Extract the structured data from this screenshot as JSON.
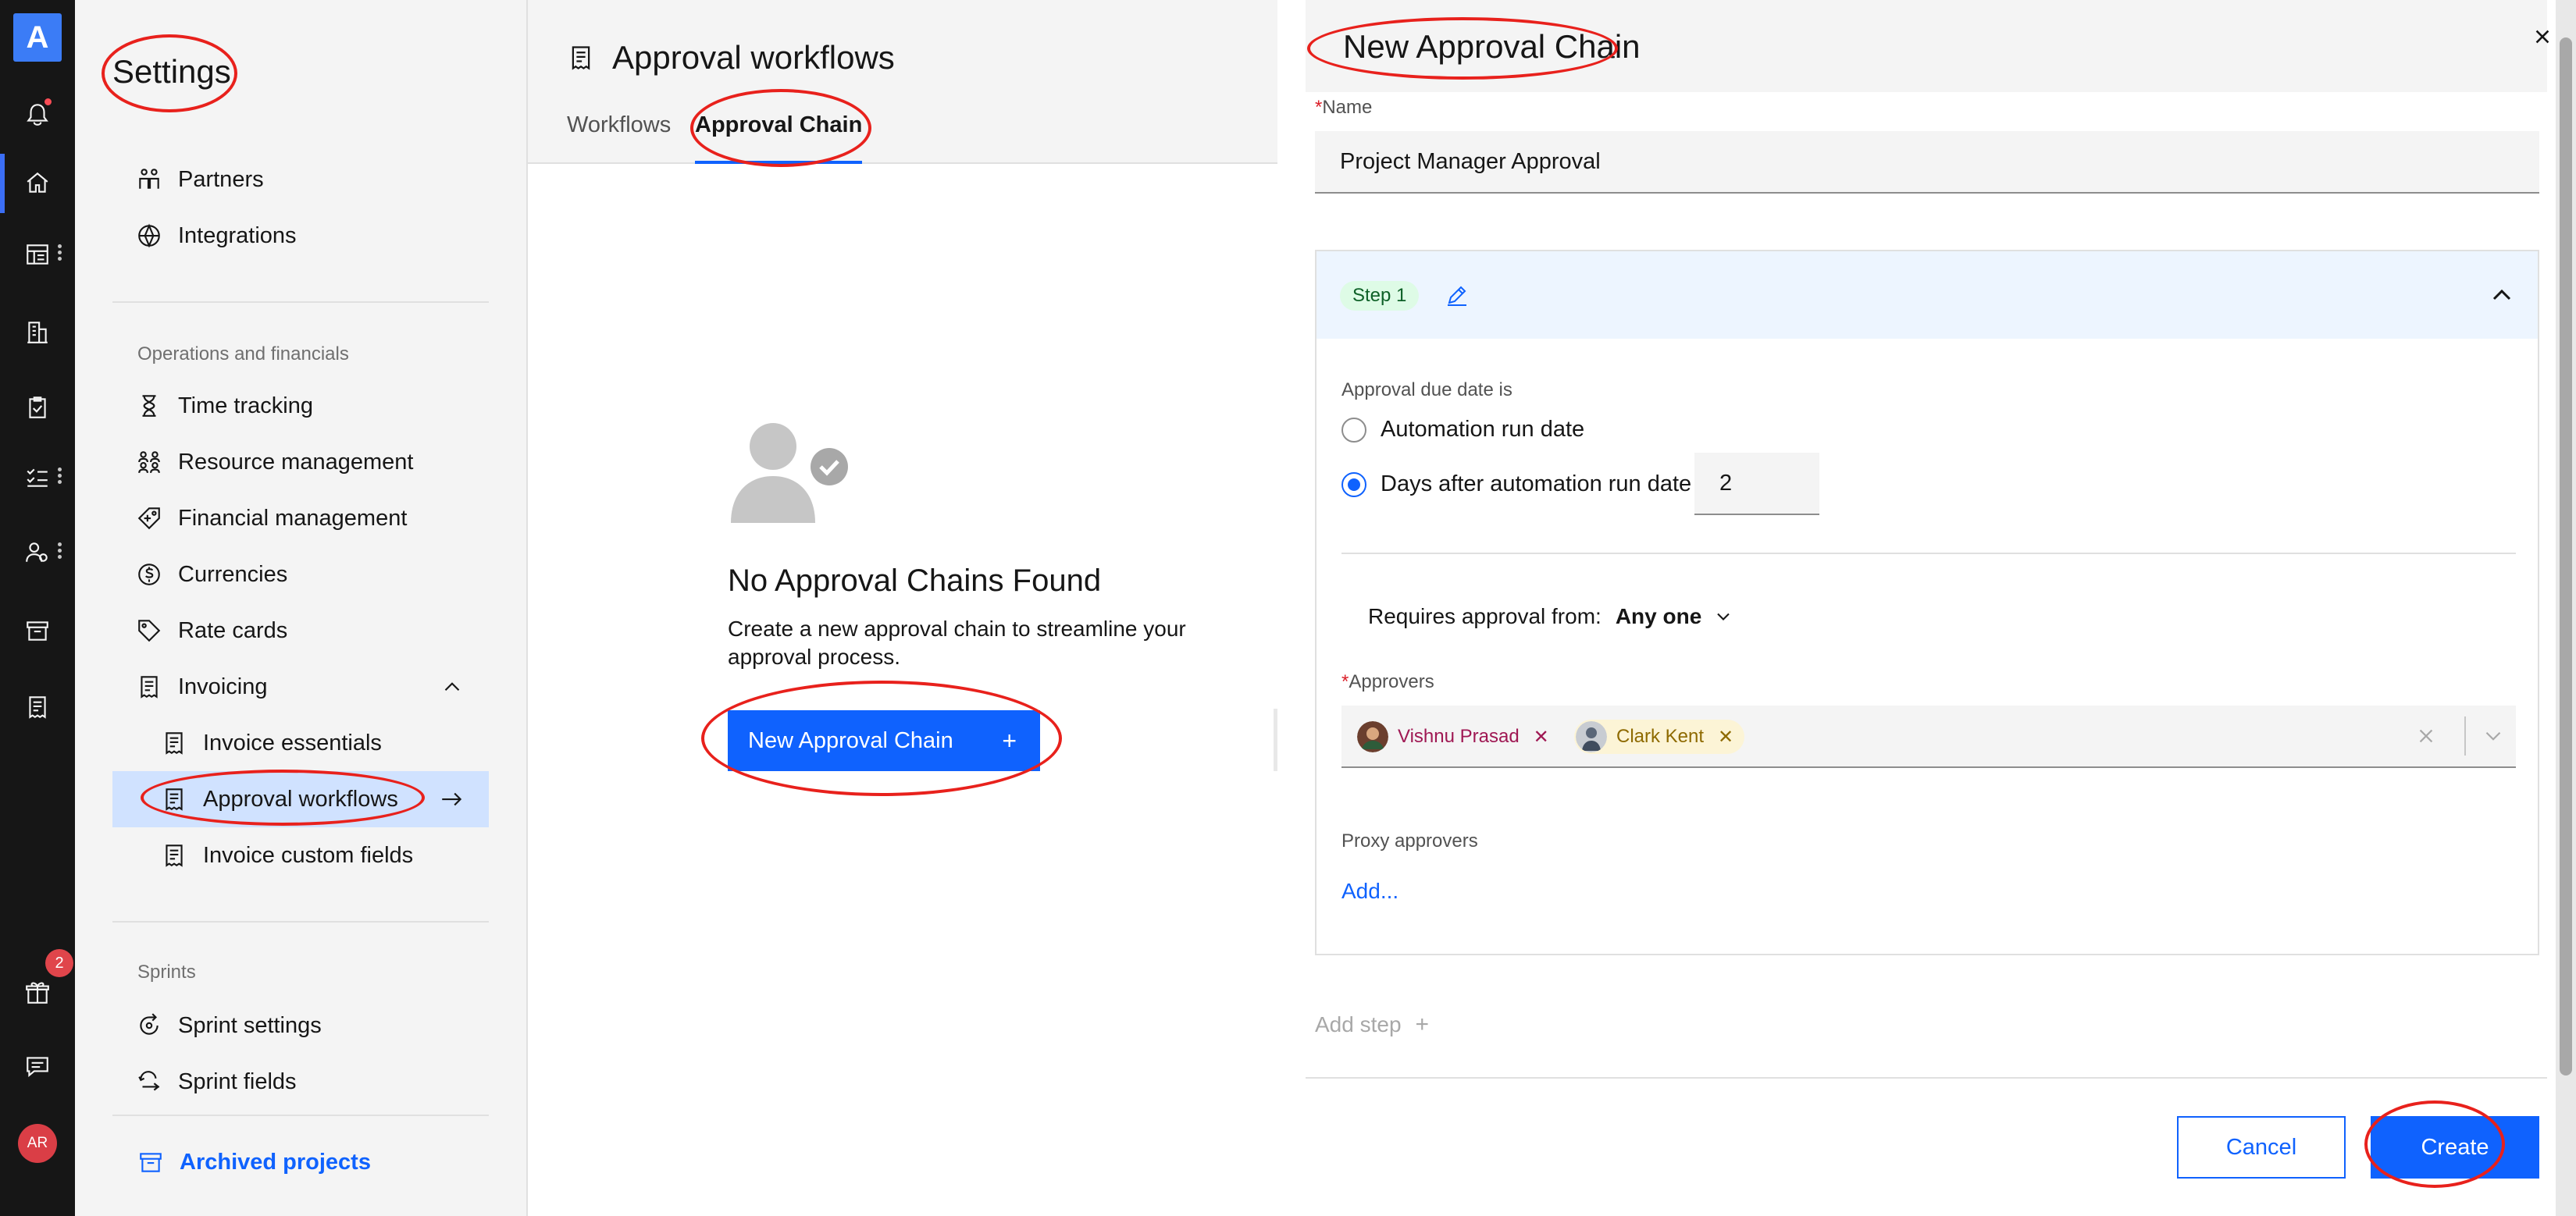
{
  "app": {
    "logo": "A",
    "notification_badge": "2",
    "user_initials": "AR"
  },
  "rail": {
    "icons": [
      "bell-icon",
      "home-icon",
      "dashboard-icon",
      "building-icon",
      "clipboard-icon",
      "task-list-icon",
      "people-icon",
      "archive-icon",
      "receipt-icon",
      "gift-icon",
      "chat-icon"
    ]
  },
  "sidebar": {
    "title": "Settings",
    "top_items": [
      {
        "label": "Partners",
        "icon": "partners-icon"
      },
      {
        "label": "Integrations",
        "icon": "integrations-icon"
      }
    ],
    "section_operations": "Operations and financials",
    "operations_items": [
      {
        "label": "Time tracking",
        "icon": "hourglass-icon"
      },
      {
        "label": "Resource management",
        "icon": "resources-icon"
      },
      {
        "label": "Financial management",
        "icon": "finance-icon"
      },
      {
        "label": "Currencies",
        "icon": "currency-icon"
      },
      {
        "label": "Rate cards",
        "icon": "tag-icon"
      },
      {
        "label": "Invoicing",
        "icon": "receipt-icon"
      }
    ],
    "invoicing_children": [
      {
        "label": "Invoice essentials",
        "icon": "receipt-icon"
      },
      {
        "label": "Approval workflows",
        "icon": "receipt-icon",
        "selected": true
      },
      {
        "label": "Invoice custom fields",
        "icon": "receipt-icon"
      }
    ],
    "section_sprints": "Sprints",
    "sprint_items": [
      {
        "label": "Sprint settings",
        "icon": "sprint-settings-icon"
      },
      {
        "label": "Sprint fields",
        "icon": "sprint-fields-icon"
      }
    ],
    "archived": "Archived projects"
  },
  "middle": {
    "title": "Approval workflows",
    "tabs": [
      {
        "label": "Workflows",
        "active": false
      },
      {
        "label": "Approval Chain",
        "active": true
      }
    ],
    "empty_title": "No Approval Chains Found",
    "empty_desc": "Create a new approval chain to streamline your approval process.",
    "new_button": "New Approval Chain",
    "new_button_icon": "+"
  },
  "drawer": {
    "title": "New Approval Chain",
    "name_label": "Name",
    "name_value": "Project Manager Approval",
    "step": {
      "tag": "Step 1",
      "due_label": "Approval due date is",
      "options": [
        {
          "label": "Automation run date",
          "checked": false
        },
        {
          "label": "Days after automation run date",
          "checked": true
        }
      ],
      "days_value": "2",
      "requires_label": "Requires approval from:",
      "requires_value": "Any one",
      "approvers_label": "Approvers",
      "approvers": [
        {
          "name": "Vishnu Prasad",
          "color": "#9f1853"
        },
        {
          "name": "Clark Kent",
          "color": "#8e6a00"
        }
      ],
      "proxy_label": "Proxy approvers",
      "proxy_add": "Add..."
    },
    "add_step": "Add step",
    "add_step_icon": "+",
    "cancel": "Cancel",
    "create": "Create"
  },
  "colors": {
    "primary": "#0f62fe",
    "rail_bg": "#161616",
    "selected_bg": "#d0e2ff",
    "annotation": "#e8211c"
  }
}
